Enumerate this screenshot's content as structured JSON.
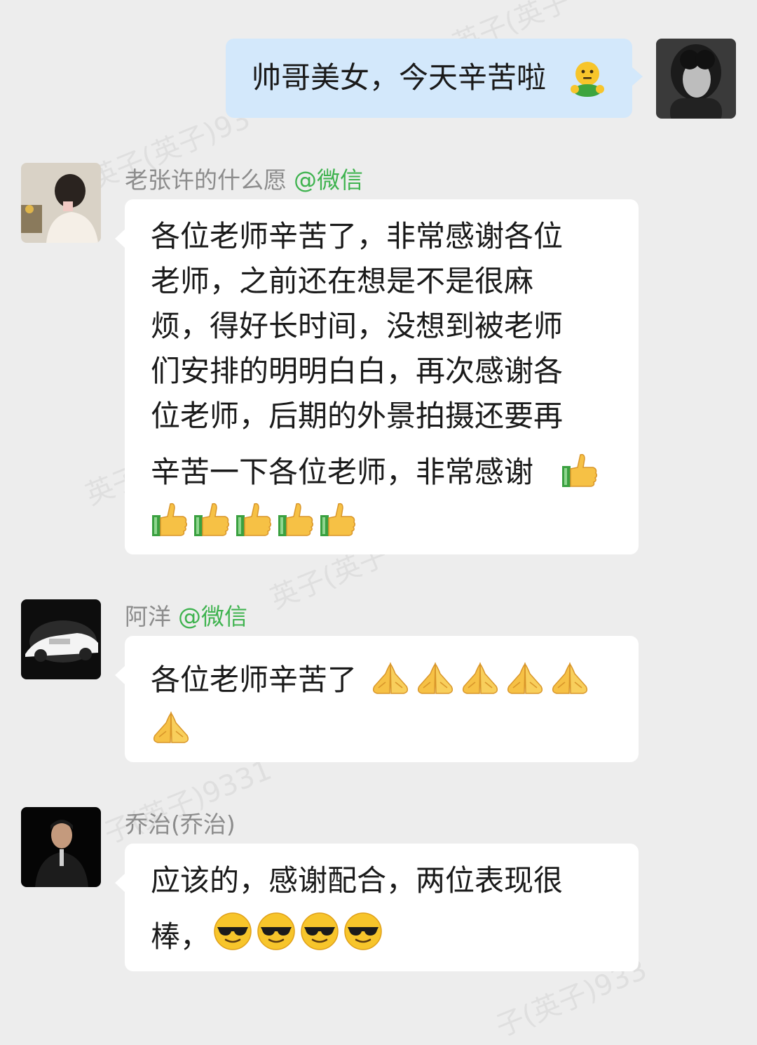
{
  "messages": [
    {
      "id": "m1",
      "side": "right",
      "text": "帅哥美女，今天辛苦啦",
      "emoji": [
        "smiley-hug-emoji"
      ]
    },
    {
      "id": "m2",
      "side": "left",
      "sender": "老张许的什么愿",
      "sender_tag": "@微信",
      "lines": [
        "各位老师辛苦了，非常感谢各位",
        "老师，之前还在想是不是很麻",
        "烦，得好长时间，没想到被老师",
        "们安排的明明白白，再次感谢各",
        "位老师，后期的外景拍摄还要再",
        "辛苦一下各位老师，非常感谢"
      ],
      "emoji": [
        "thumbs-up-emoji",
        "thumbs-up-emoji",
        "thumbs-up-emoji",
        "thumbs-up-emoji",
        "thumbs-up-emoji",
        "thumbs-up-emoji"
      ]
    },
    {
      "id": "m3",
      "side": "left",
      "sender": "阿洋",
      "sender_tag": "@微信",
      "text": "各位老师辛苦了",
      "emoji": [
        "pray-emoji",
        "pray-emoji",
        "pray-emoji",
        "pray-emoji",
        "pray-emoji",
        "pray-emoji"
      ]
    },
    {
      "id": "m4",
      "side": "left",
      "sender": "乔治(乔治)",
      "lines": [
        "应该的，感谢配合，两位表现很",
        "棒，"
      ],
      "emoji": [
        "sunglasses-emoji",
        "sunglasses-emoji",
        "sunglasses-emoji",
        "sunglasses-emoji"
      ]
    }
  ],
  "watermark": "英子(英子)9331",
  "colors": {
    "background": "#ededed",
    "bubble_self": "#d3e8fb",
    "bubble_other": "#ffffff",
    "wechat_tag": "#3fb34f"
  }
}
